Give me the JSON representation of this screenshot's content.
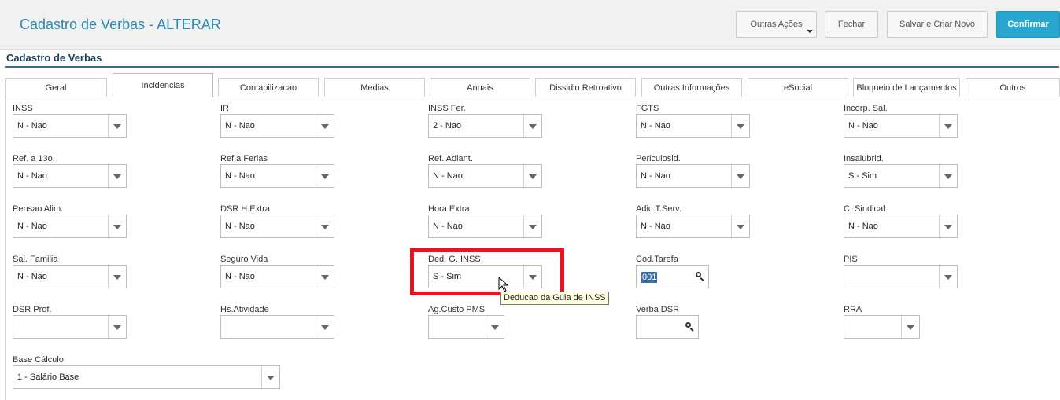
{
  "header": {
    "title": "Cadastro de Verbas - ALTERAR",
    "buttons": {
      "outras_acoes": "Outras Ações",
      "fechar": "Fechar",
      "salvar_criar_novo": "Salvar e Criar Novo",
      "confirmar": "Confirmar"
    }
  },
  "section": {
    "title": "Cadastro de Verbas"
  },
  "tabs": [
    {
      "label": "Geral"
    },
    {
      "label": "Incidencias",
      "active": true
    },
    {
      "label": "Contabilizacao"
    },
    {
      "label": "Medias"
    },
    {
      "label": "Anuais"
    },
    {
      "label": "Dissidio Retroativo"
    },
    {
      "label": "Outras Informações"
    },
    {
      "label": "eSocial"
    },
    {
      "label": "Bloqueio de Lançamentos"
    },
    {
      "label": "Outros"
    }
  ],
  "fields": {
    "inss": {
      "label": "INSS",
      "value": "N - Nao"
    },
    "ir": {
      "label": "IR",
      "value": "N - Nao"
    },
    "inss_fer": {
      "label": "INSS Fer.",
      "value": "2 - Nao"
    },
    "fgts": {
      "label": "FGTS",
      "value": "N - Nao"
    },
    "incorp_sal": {
      "label": "Incorp. Sal.",
      "value": "N - Nao"
    },
    "ref_13o": {
      "label": "Ref. a 13o.",
      "value": "N - Nao"
    },
    "ref_ferias": {
      "label": "Ref.a Ferias",
      "value": "N - Nao"
    },
    "ref_adiant": {
      "label": "Ref. Adiant.",
      "value": "N - Nao"
    },
    "periculosid": {
      "label": "Periculosid.",
      "value": "N - Nao"
    },
    "insalubrid": {
      "label": "Insalubrid.",
      "value": "S - Sim"
    },
    "pensao_alim": {
      "label": "Pensao Alim.",
      "value": "N - Nao"
    },
    "dsr_hextra": {
      "label": "DSR H.Extra",
      "value": "N - Nao"
    },
    "hora_extra": {
      "label": "Hora Extra",
      "value": "N - Nao"
    },
    "adic_tserv": {
      "label": "Adic.T.Serv.",
      "value": "N - Nao"
    },
    "c_sindical": {
      "label": "C. Sindical",
      "value": "N - Nao"
    },
    "sal_familia": {
      "label": "Sal. Familia",
      "value": "N - Nao"
    },
    "seguro_vida": {
      "label": "Seguro Vida",
      "value": "N - Nao"
    },
    "ded_g_inss": {
      "label": "Ded. G. INSS",
      "value": "S - Sim"
    },
    "cod_tarefa": {
      "label": "Cod.Tarefa",
      "value": "001"
    },
    "pis": {
      "label": "PIS",
      "value": ""
    },
    "dsr_prof": {
      "label": "DSR Prof.",
      "value": ""
    },
    "hs_atividade": {
      "label": "Hs.Atividade",
      "value": ""
    },
    "ag_custo_pms": {
      "label": "Ag.Custo PMS",
      "value": ""
    },
    "verba_dsr": {
      "label": "Verba DSR",
      "value": ""
    },
    "rra": {
      "label": "RRA",
      "value": ""
    },
    "base_calculo": {
      "label": "Base Cálculo",
      "value": "1 - Salário Base"
    }
  },
  "tooltip": {
    "text": "Deducao da Guia de INSS"
  },
  "colors": {
    "accent": "#29a6cf",
    "title": "#2a8cb0",
    "highlight": "#e8141b"
  }
}
